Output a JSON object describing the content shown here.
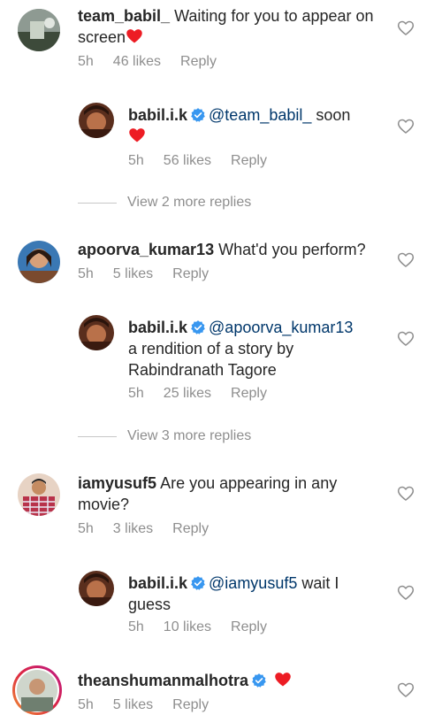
{
  "colors": {
    "meta_text": "#8e8e8e",
    "mention": "#00376b",
    "heart": "#ed1c24",
    "verified": "#3897f0"
  },
  "icons": {
    "like": "heart-outline-icon",
    "verified": "verified-badge-icon",
    "emoji": "red-heart-emoji"
  },
  "thread1": {
    "comment": {
      "username": "team_babil_",
      "text": "Waiting for you to appear on screen",
      "time": "5h",
      "likes": "46 likes",
      "reply": "Reply"
    },
    "reply": {
      "username": "babil.i.k",
      "mention": "@team_babil_",
      "text": "soon",
      "time": "5h",
      "likes": "56 likes",
      "reply": "Reply"
    },
    "view_more": "View 2 more replies"
  },
  "thread2": {
    "comment": {
      "username": "apoorva_kumar13",
      "text": "What'd you perform?",
      "time": "5h",
      "likes": "5 likes",
      "reply": "Reply"
    },
    "reply": {
      "username": "babil.i.k",
      "mention": "@apoorva_kumar13",
      "text_line1": "a rendition of a story by",
      "text_line2": "Rabindranath Tagore",
      "time": "5h",
      "likes": "25 likes",
      "reply": "Reply"
    },
    "view_more": "View 3 more replies"
  },
  "thread3": {
    "comment": {
      "username": "iamyusuf5",
      "text": "Are you appearing in any movie?",
      "time": "5h",
      "likes": "3 likes",
      "reply": "Reply"
    },
    "reply": {
      "username": "babil.i.k",
      "mention": "@iamyusuf5",
      "text": "wait I guess",
      "time": "5h",
      "likes": "10 likes",
      "reply": "Reply"
    }
  },
  "thread4": {
    "comment": {
      "username": "theanshumanmalhotra",
      "time": "5h",
      "likes": "5 likes",
      "reply": "Reply"
    }
  }
}
